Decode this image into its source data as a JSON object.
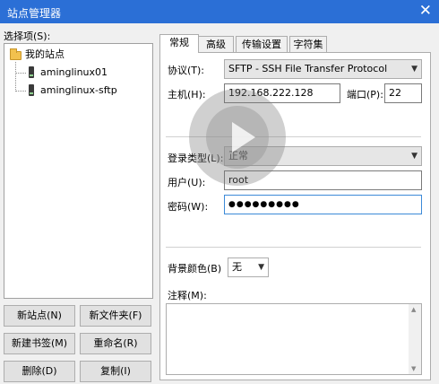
{
  "window": {
    "title": "站点管理器",
    "close_glyph": "✕"
  },
  "left": {
    "label": "选择项(S):",
    "tree": {
      "root": "我的站点",
      "children": [
        "aminglinux01",
        "aminglinux-sftp"
      ]
    },
    "buttons": {
      "new_site": "新站点(N)",
      "new_folder": "新文件夹(F)",
      "new_bookmark": "新建书签(M)",
      "rename": "重命名(R)",
      "delete": "删除(D)",
      "copy": "复制(I)"
    }
  },
  "tabs": [
    "常规",
    "高级",
    "传输设置",
    "字符集"
  ],
  "general": {
    "protocol_label": "协议(T):",
    "protocol_value": "SFTP - SSH File Transfer Protocol",
    "host_label": "主机(H):",
    "host_value": "192.168.222.128",
    "port_label": "端口(P):",
    "port_value": "22",
    "logon_type_label": "登录类型(L):",
    "logon_type_value": "正常",
    "user_label": "用户(U):",
    "user_value": "root",
    "password_label": "密码(W):",
    "password_value": "●●●●●●●●●",
    "bg_color_label": "背景颜色(B)",
    "bg_color_value": "无",
    "comment_label": "注释(M):",
    "comment_value": ""
  },
  "icons": {
    "dropdown": "chevron-down-icon",
    "folder": "folder-icon",
    "server": "server-icon",
    "overlay": "play-icon"
  },
  "colors": {
    "titlebar": "#2b6fd6",
    "focus_border": "#3c8ad8"
  }
}
